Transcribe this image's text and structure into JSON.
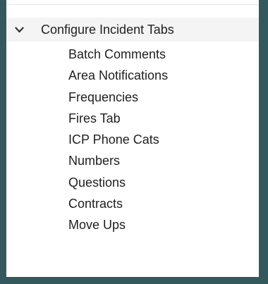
{
  "tree": {
    "parent": {
      "label": "Configure Incident Tabs",
      "icon": "chevron-down-icon",
      "expanded": true
    },
    "children": [
      {
        "label": "Batch Comments"
      },
      {
        "label": "Area Notifications"
      },
      {
        "label": "Frequencies"
      },
      {
        "label": "Fires Tab"
      },
      {
        "label": "ICP Phone Cats"
      },
      {
        "label": "Numbers"
      },
      {
        "label": "Questions"
      },
      {
        "label": "Contracts"
      },
      {
        "label": "Move Ups"
      }
    ]
  },
  "colors": {
    "frame": "#34595d",
    "panel": "#ffffff",
    "selected_row": "#f4f4f4",
    "text": "#1f1f1f"
  }
}
